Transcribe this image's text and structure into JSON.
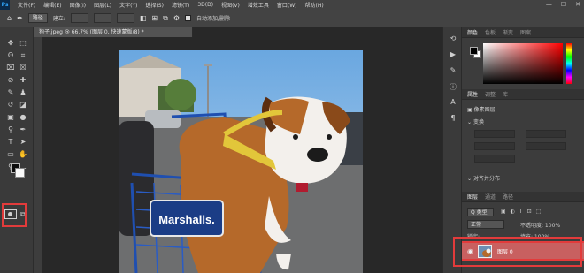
{
  "app": {
    "logo": "Ps"
  },
  "menubar": {
    "items": [
      "文件(F)",
      "编辑(E)",
      "图像(I)",
      "图层(L)",
      "文字(Y)",
      "选择(S)",
      "滤镜(T)",
      "3D(D)",
      "视图(V)",
      "增效工具",
      "窗口(W)",
      "帮助(H)"
    ],
    "window_buttons": [
      "—",
      "☐",
      "✕"
    ]
  },
  "options_bar": {
    "home_icon": "home-icon",
    "mode_value": "路径",
    "make_label": "建立:",
    "selection_label": "选区...",
    "mask_label": "蒙版",
    "shape_label": "形状",
    "auto_add_delete": "自动添加/删除"
  },
  "document": {
    "tab_title": "狗子.jpeg @ 66.7% (图层 0, 快速蒙版/8) *",
    "photo_text": "Marshalls."
  },
  "panels": {
    "color_tabs": [
      "颜色",
      "色板",
      "渐变",
      "图案"
    ],
    "properties_tabs": [
      "属性",
      "调整",
      "库"
    ],
    "properties_header": "像素图层",
    "transform_label": "变换",
    "align_label": "对齐并分布",
    "layers_tabs": [
      "图层",
      "通道",
      "路径"
    ],
    "layer_filter": "Q 类型",
    "blend_mode": "正常",
    "opacity_label": "不透明度: 100%",
    "lock_label": "锁定:",
    "fill_label": "填充: 100%",
    "layer_name": "图层 0"
  },
  "colors": {
    "highlight": "#e23b3b",
    "selected_layer": "#c86060"
  }
}
